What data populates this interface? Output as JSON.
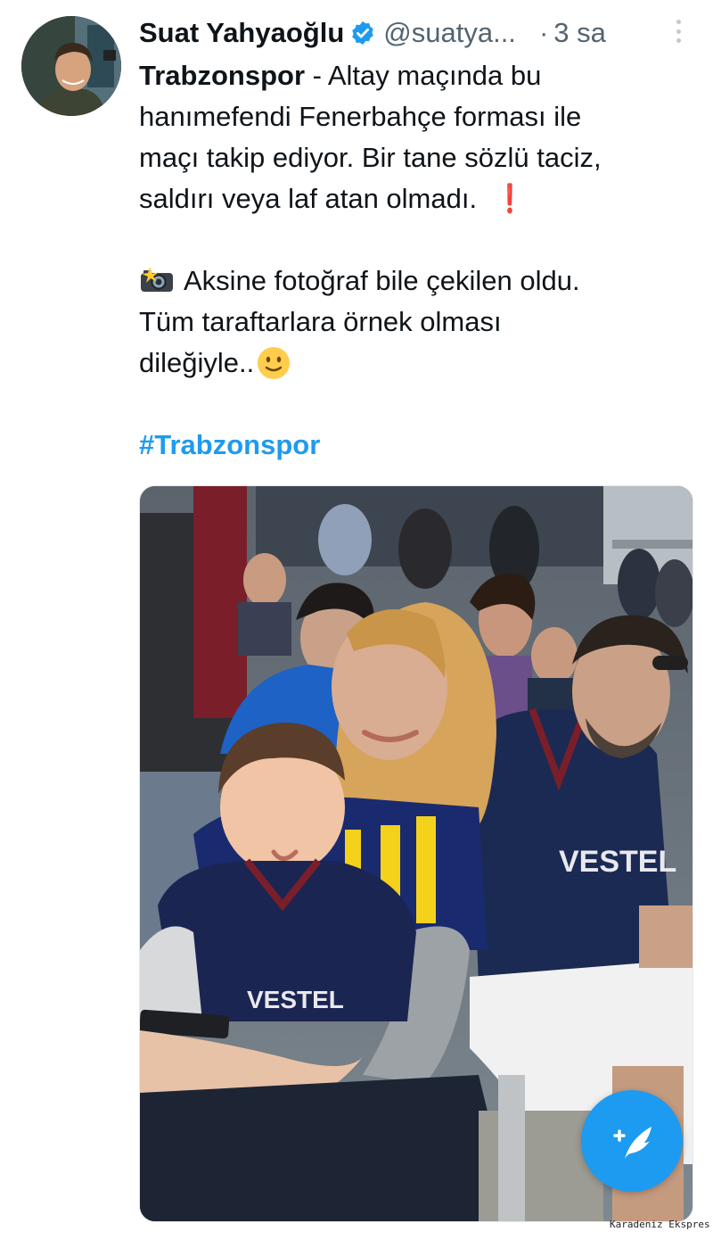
{
  "author": {
    "display_name": "Suat Yahyaoğlu",
    "handle": "@suatya...",
    "time": "3 sa",
    "verified": true
  },
  "tweet": {
    "lead_bold": "Trabzonspor",
    "line1_rest": " - Altay maçında bu",
    "line2": "hanımefendi Fenerbahçe forması ile",
    "line3": "maçı takip ediyor. Bir tane sözlü taciz,",
    "line4": "saldırı veya laf atan olmadı.",
    "line5": "Aksine fotoğraf bile çekilen oldu.",
    "line6": "Tüm taraftarlara örnek olması",
    "line7": "dileğiyle..",
    "hashtag": "#Trabzonspor",
    "exclamation": "❗"
  },
  "media": {
    "shirt_text_child": "VESTEL",
    "shirt_text_man": "VESTEL"
  },
  "icons": {
    "verified": "verified-badge-icon",
    "more": "more-vertical-icon",
    "camera": "camera-flash-emoji",
    "smile": "slightly-smiling-emoji",
    "compose": "compose-tweet-icon"
  },
  "colors": {
    "accent": "#1d9bf0",
    "secondary_text": "#536471",
    "exclaim": "#dd2e44"
  },
  "watermark": "Karadeniz Ekspres"
}
